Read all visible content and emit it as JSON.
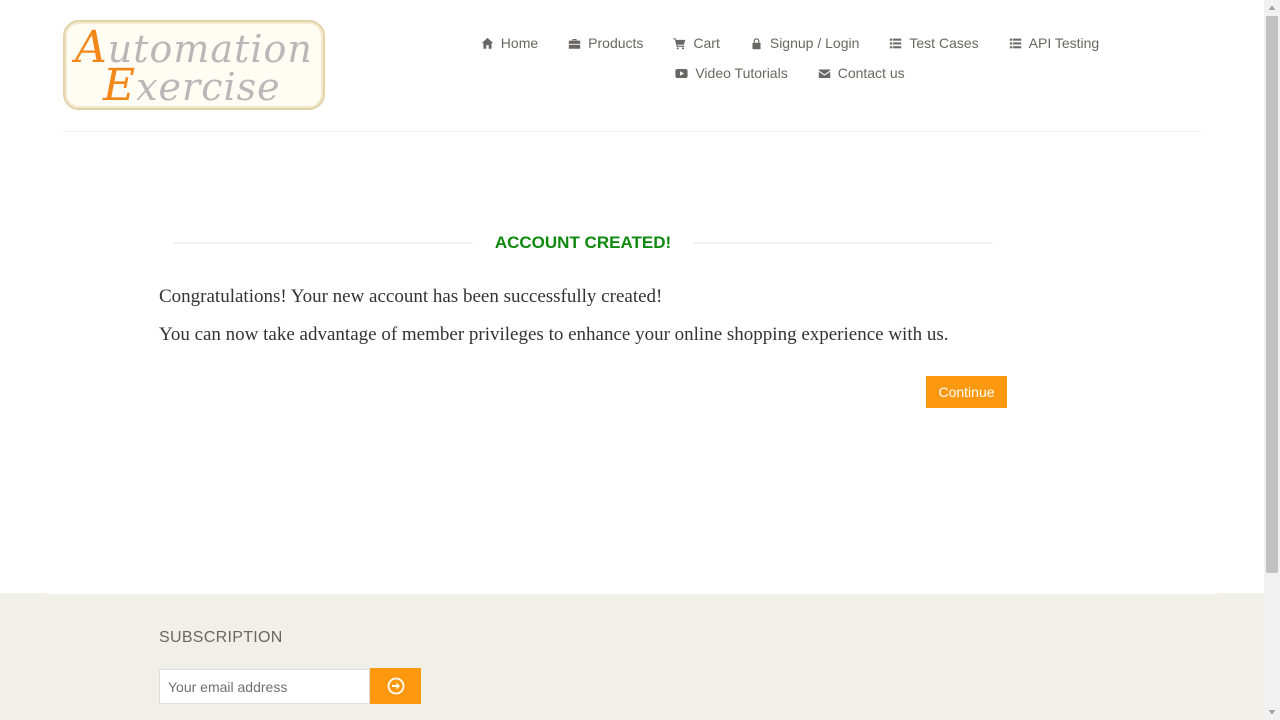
{
  "header": {
    "logo_text": "Automation Exercise",
    "logo": {
      "line1_initial": "A",
      "line1_rest": "utomation",
      "line2_initial": "E",
      "line2_rest": "xercise"
    },
    "nav": {
      "row1": [
        {
          "label": "Home",
          "icon": "home-icon"
        },
        {
          "label": "Products",
          "icon": "briefcase-icon"
        },
        {
          "label": "Cart",
          "icon": "cart-icon"
        },
        {
          "label": "Signup / Login",
          "icon": "lock-icon"
        },
        {
          "label": "Test Cases",
          "icon": "list-icon"
        },
        {
          "label": "API Testing",
          "icon": "list-icon"
        }
      ],
      "row2": [
        {
          "label": "Video Tutorials",
          "icon": "youtube-play-icon"
        },
        {
          "label": "Contact us",
          "icon": "envelope-icon"
        }
      ]
    }
  },
  "main": {
    "title": "ACCOUNT CREATED!",
    "message1": "Congratulations! Your new account has been successfully created!",
    "message2": "You can now take advantage of member privileges to enhance your online shopping experience with us.",
    "continue_label": "Continue"
  },
  "footer": {
    "subscription_title": "SUBSCRIPTION",
    "email_placeholder": "Your email address",
    "subscribe_icon": "arrow-circle-right-icon"
  },
  "colors": {
    "accent": "#FE980F",
    "success": "#0F8A0F",
    "nav_text": "#696763",
    "footer_bg": "#F0F0E9",
    "logo_orange": "#F28617"
  }
}
